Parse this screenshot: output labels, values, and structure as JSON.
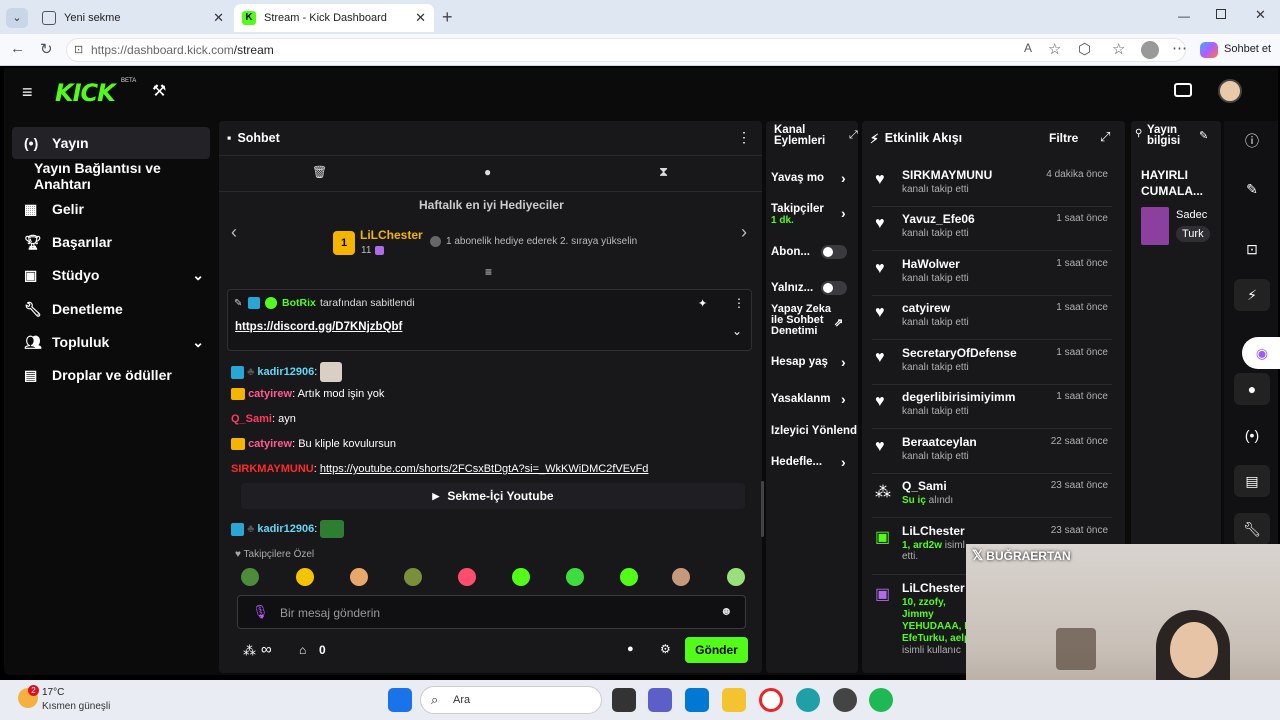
{
  "browser": {
    "tabs": [
      {
        "label": "Yeni sekme"
      },
      {
        "label": "Stream - Kick Dashboard"
      }
    ],
    "url_prefix": "https://dashboard.kick.com",
    "url_path": "/stream",
    "chat_label": "Sohbet et"
  },
  "app": {
    "logo": "KICK",
    "beta": "BETA"
  },
  "sidebar": {
    "items": [
      {
        "label": "Yayın"
      },
      {
        "label": "Yayın Bağlantısı ve Anahtarı"
      },
      {
        "label": "Gelir"
      },
      {
        "label": "Başarılar"
      },
      {
        "label": "Stüdyo"
      },
      {
        "label": "Denetleme"
      },
      {
        "label": "Topluluk"
      },
      {
        "label": "Droplar ve ödüller"
      }
    ]
  },
  "chat": {
    "title": "Sohbet",
    "gifters_title": "Haftalık en iyi Hediyeciler",
    "top_gifter": "LiLChester",
    "top_gifter_count": "11",
    "rank": "1",
    "gifter_hint": "1 abonelik hediye ederek 2. sıraya yükselin",
    "pinned": {
      "by_user": "BotRix",
      "by_text": "tarafından sabitlendi",
      "link": "https://discord.gg/D7KNjzbQbf"
    },
    "messages": [
      {
        "user": "kadir12906",
        "text": ":"
      },
      {
        "user": "catyirew",
        "text": ": Artık mod işin yok"
      },
      {
        "user": "Q_Sami",
        "text": ": ayn"
      },
      {
        "user": "catyirew",
        "text": ": Bu kliple kovulursun"
      },
      {
        "user": "SIRKMAYMUNU",
        "text": ": ",
        "link": "https://youtube.com/shorts/2FCsxBtDgtA?si=_WkKWiDMC2fVEvFd"
      },
      {
        "user": "kadir12906",
        "text": ":"
      }
    ],
    "youtube_button": "Sekme-İçi Youtube",
    "followers_only": "Takipçilere Özel",
    "placeholder": "Bir mesaj gönderin",
    "infinity": "∞",
    "points": "0",
    "send": "Gönder"
  },
  "actions": {
    "title": "Kanal Eylemleri",
    "items": [
      {
        "label": "Yavaş mo"
      },
      {
        "label": "Takipçiler",
        "sub": "1 dk."
      },
      {
        "label": "Abon..."
      },
      {
        "label": "Yalnız..."
      },
      {
        "label": "Yapay Zeka ile Sohbet Denetimi"
      },
      {
        "label": "Hesap yaş"
      },
      {
        "label": "Yasaklanm"
      },
      {
        "label": "İzleyici Yönlend"
      },
      {
        "label": "Hedefle..."
      }
    ]
  },
  "activity": {
    "title": "Etkinlik Akışı",
    "filter": "Filtre",
    "events": [
      {
        "name": "SIRKMAYMUNU",
        "sub": "kanalı takip etti",
        "time": "4 dakika önce"
      },
      {
        "name": "Yavuz_Efe06",
        "sub": "kanalı takip etti",
        "time": "1 saat önce"
      },
      {
        "name": "HaWolwer",
        "sub": "kanalı takip etti",
        "time": "1 saat önce"
      },
      {
        "name": "catyirew",
        "sub": "kanalı takip etti",
        "time": "1 saat önce"
      },
      {
        "name": "SecretaryOfDefense",
        "sub": "kanalı takip etti",
        "time": "1 saat önce"
      },
      {
        "name": "degerlibirisimiyimm",
        "sub": "kanalı takip etti",
        "time": "1 saat önce"
      },
      {
        "name": "Beraatceylan",
        "sub": "kanalı takip etti",
        "time": "22 saat önce"
      },
      {
        "name": "Q_Sami",
        "sub_green": "Su iç",
        "sub": " alındı",
        "time": "23 saat önce"
      },
      {
        "name": "LiLChester",
        "sub_green": "1, ard2w",
        "sub": " isiml",
        "sub2": "etti.",
        "time": "23 saat önce"
      },
      {
        "name": "LiLChester",
        "sub_green": "10, zzofy, Jimmy YEHUDAAA, L EfeTurku, aelp",
        "sub": "isimli kullanıc",
        "time": ""
      }
    ]
  },
  "info": {
    "title": "Yayın bilgisi",
    "stream_title": "HAYIRLI CUMALA...",
    "category": "Sadec",
    "tag": "Turk"
  },
  "overlay": {
    "handle": "BUĞRAERTAN"
  },
  "taskbar": {
    "temp": "17°C",
    "weather": "Kısmen güneşli",
    "search": "Ara",
    "badge": "2"
  },
  "colors": {
    "kick_green": "#53fc18",
    "panel": "#18181b",
    "bg": "#0b0b0c"
  }
}
